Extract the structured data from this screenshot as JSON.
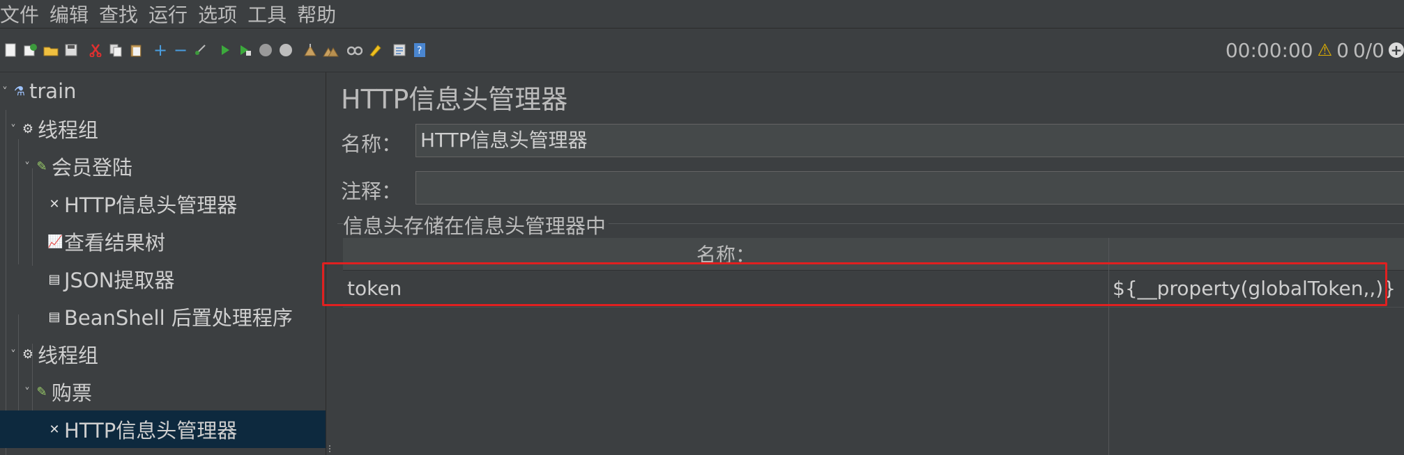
{
  "menubar": {
    "items": [
      "文件",
      "编辑",
      "查找",
      "运行",
      "选项",
      "工具",
      "帮助"
    ]
  },
  "toolbar": {
    "icons": [
      "new-icon",
      "templates-icon",
      "open-icon",
      "save-icon",
      "cut-icon",
      "copy-icon",
      "paste-icon",
      "expand-icon",
      "collapse-icon",
      "toggle-icon",
      "start-icon",
      "start-no-pause-icon",
      "stop-icon",
      "shutdown-icon",
      "clear-icon",
      "clear-all-icon",
      "search-icon",
      "reset-search-icon",
      "function-helper-icon",
      "help-icon"
    ],
    "timer": "00:00:00",
    "warning_count": "0",
    "thread_count": "0/0"
  },
  "tree": {
    "items": [
      {
        "label": "train",
        "icon": "test-plan-icon"
      },
      {
        "label": "线程组",
        "icon": "gear-icon"
      },
      {
        "label": "会员登陆",
        "icon": "sampler-icon"
      },
      {
        "label": "HTTP信息头管理器",
        "icon": "config-icon"
      },
      {
        "label": "查看结果树",
        "icon": "listener-icon"
      },
      {
        "label": "JSON提取器",
        "icon": "postprocessor-icon"
      },
      {
        "label": "BeanShell 后置处理程序",
        "icon": "postprocessor-icon"
      },
      {
        "label": "线程组",
        "icon": "gear-icon"
      },
      {
        "label": "购票",
        "icon": "sampler-icon"
      },
      {
        "label": "HTTP信息头管理器",
        "icon": "config-icon"
      }
    ]
  },
  "panel": {
    "title": "HTTP信息头管理器",
    "name_label": "名称：",
    "name_value": "HTTP信息头管理器",
    "comment_label": "注释：",
    "comment_value": "",
    "group_title": "信息头存储在信息头管理器中",
    "table": {
      "col_name": "名称：",
      "col_value": "",
      "rows": [
        {
          "name": "token",
          "value": "${__property(globalToken,,)}"
        }
      ]
    }
  },
  "colors": {
    "background": "#3c3f41",
    "selection": "#0d293e",
    "highlight_box": "#e02020"
  }
}
